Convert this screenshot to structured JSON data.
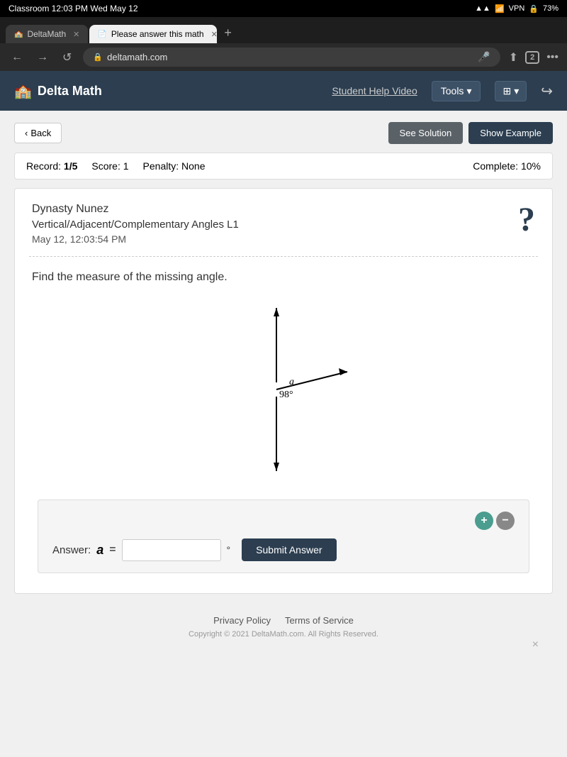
{
  "statusBar": {
    "left": "Classroom  12:03 PM  Wed May 12",
    "signal": "▲▲▲",
    "wifi": "wifi",
    "vpn": "VPN",
    "battery": "73%"
  },
  "tabs": [
    {
      "id": "tab1",
      "label": "DeltaMath",
      "active": false,
      "icon": "🏫"
    },
    {
      "id": "tab2",
      "label": "Please answer this math",
      "active": true,
      "icon": "📄"
    }
  ],
  "urlBar": {
    "url": "deltamath.com",
    "back": "←",
    "forward": "→",
    "reload": "↺"
  },
  "header": {
    "logo": "Delta Math",
    "helpVideo": "Student Help Video",
    "tools": "Tools",
    "logout": "logout"
  },
  "actionBar": {
    "back": "‹ Back",
    "seeSolution": "See Solution",
    "showExample": "Show Example"
  },
  "recordBar": {
    "record": "Record:",
    "recordValue": "1/5",
    "scoreLabel": "Score:",
    "scoreValue": "1",
    "penaltyLabel": "Penalty:",
    "penaltyValue": "None",
    "completeLabel": "Complete:",
    "completeValue": "10%"
  },
  "problem": {
    "studentName": "Dynasty Nunez",
    "problemType": "Vertical/Adjacent/Complementary Angles L1",
    "timestamp": "May 12, 12:03:54 PM",
    "helpIcon": "?",
    "question": "Find the measure of the missing angle.",
    "diagram": {
      "angle": "98°",
      "variable": "a"
    }
  },
  "answer": {
    "label": "Answer:",
    "variable": "a",
    "equals": "=",
    "degree": "°",
    "submit": "Submit Answer",
    "zoomPlus": "+",
    "zoomMinus": "−"
  },
  "footer": {
    "privacyPolicy": "Privacy Policy",
    "termsOfService": "Terms of Service",
    "copyright": "Copyright © 2021 DeltaMath.com. All Rights Reserved.",
    "close": "×"
  }
}
